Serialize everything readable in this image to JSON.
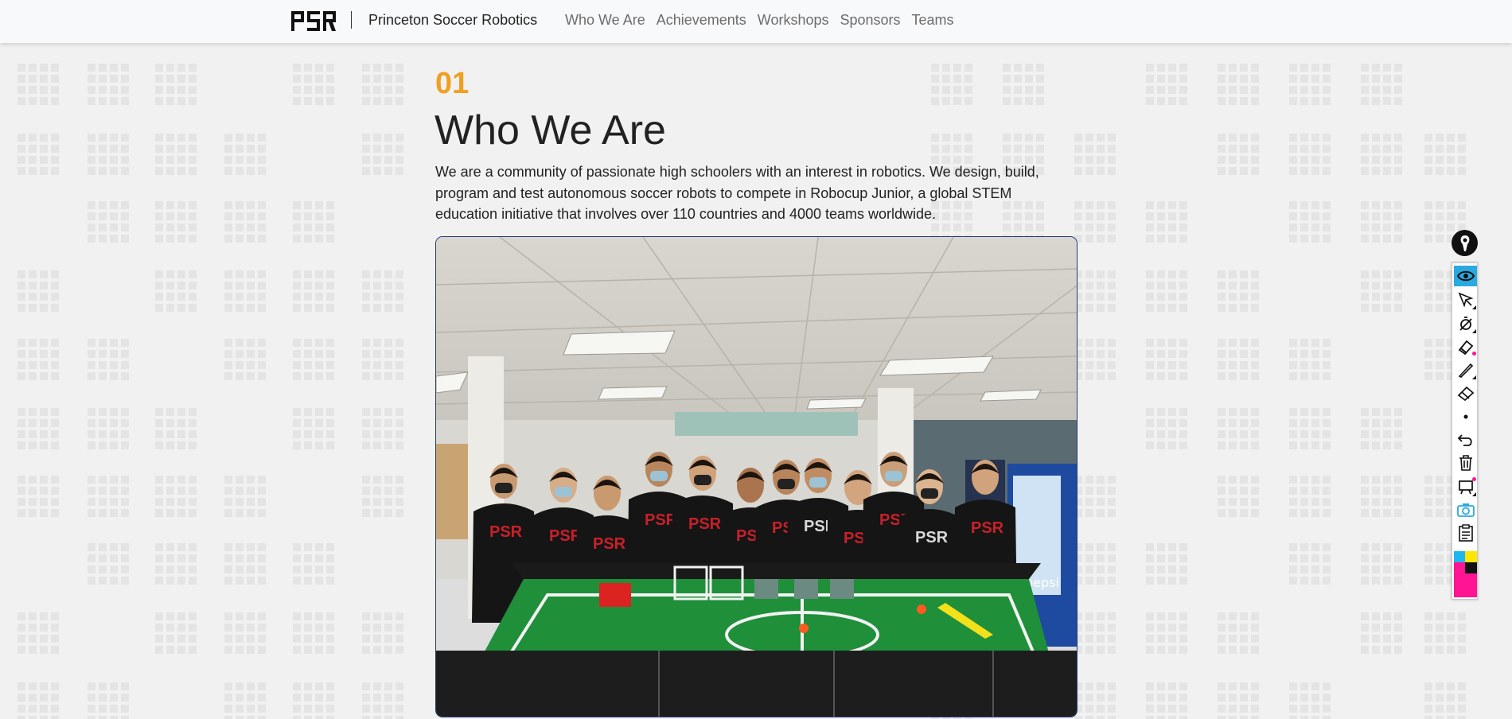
{
  "header": {
    "logo_text": "PSR",
    "brand": "Princeton Soccer Robotics",
    "nav": [
      "Who We Are",
      "Achievements",
      "Workshops",
      "Sponsors",
      "Teams"
    ]
  },
  "section": {
    "number": "01",
    "title": "Who We Are",
    "description": "We are a community of passionate high schoolers with an interest in robotics. We design, build, program and test autonomous soccer robots to compete in Robocup Junior, a global STEM education initiative that involves over 110 countries and 4000 teams worldwide.",
    "photo": {
      "shirt_text": "PSR",
      "vending_text": "pepsi"
    }
  },
  "toolbar": {
    "icons": [
      "pen-logo-icon",
      "eye-icon",
      "cursor-icon",
      "laser-pointer-icon",
      "highlighter-icon",
      "pen-icon",
      "eraser-icon",
      "dot-size-icon",
      "undo-icon",
      "trash-icon",
      "board-icon",
      "camera-icon",
      "clipboard-icon"
    ],
    "palette_colors": [
      "#1fb6ef",
      "#ffe600",
      "#ff1493",
      "#111111"
    ]
  },
  "colors": {
    "accent": "#f0a020",
    "active_tool": "#2aa9df"
  }
}
